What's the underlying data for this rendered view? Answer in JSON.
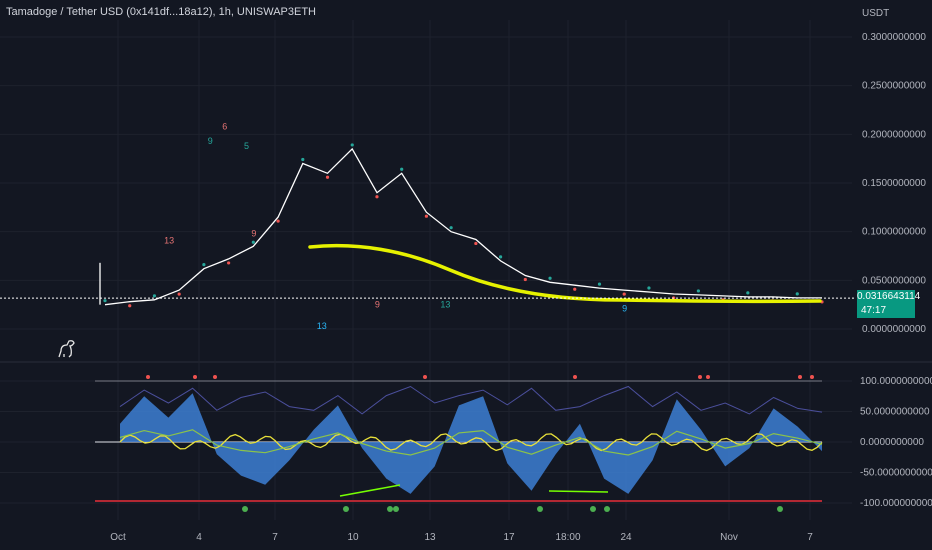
{
  "header": {
    "title": "Tamadoge / Tether USD (0x141df...18a12), 1h, UNISWAP3ETH",
    "currency": "USDT"
  },
  "last_price": {
    "value": "0.0316643114",
    "countdown": "47:17"
  },
  "colors": {
    "background": "#131722",
    "up": "#26a69a",
    "down": "#ef5350",
    "price_line": "#ffffff",
    "drawing": "#e6f200",
    "oscillator_fill": "#3d7fd4",
    "oscillator_line": "#4b4f9c",
    "fast_line": "#e8e03a",
    "signal_line": "#8bc34a"
  },
  "chart_data": [
    {
      "type": "line",
      "title": "Tamadoge / Tether USD (0x141df...18a12), 1h, UNISWAP3ETH",
      "y_axis_ticks": [
        "0.3000000000",
        "0.2500000000",
        "0.2000000000",
        "0.1500000000",
        "0.1000000000",
        "0.0500000000",
        "0.0000000000"
      ],
      "ylim": [
        0,
        0.3
      ],
      "x_tick_labels": [
        "Oct",
        "4",
        "7",
        "10",
        "13",
        "17",
        "18:00",
        "24",
        "Nov",
        "7"
      ],
      "series": [
        {
          "values": [
            0.025,
            0.028,
            0.03,
            0.04,
            0.062,
            0.072,
            0.085,
            0.115,
            0.17,
            0.16,
            0.185,
            0.14,
            0.16,
            0.12,
            0.1,
            0.092,
            0.07,
            0.055,
            0.048,
            0.045,
            0.042,
            0.04,
            0.038,
            0.036,
            0.035,
            0.034,
            0.033,
            0.033,
            0.032,
            0.032
          ]
        }
      ],
      "annotations": [
        "13",
        "9",
        "6",
        "5",
        "9",
        "13",
        "9",
        "13",
        "9"
      ],
      "last_value": 0.0316643114
    },
    {
      "type": "area",
      "y_axis_ticks": [
        "100.0000000000",
        "50.0000000000",
        "0.0000000000",
        "-50.0000000000",
        "-100.0000000000"
      ],
      "ylim": [
        -100,
        100
      ],
      "series": [
        {
          "values": [
            30,
            75,
            40,
            80,
            -20,
            -55,
            -70,
            -30,
            20,
            60,
            -10,
            -60,
            -85,
            -40,
            60,
            75,
            -35,
            -80,
            -20,
            30,
            -60,
            -85,
            -30,
            70,
            20,
            -40,
            -10,
            55,
            25,
            -15
          ]
        }
      ]
    }
  ]
}
